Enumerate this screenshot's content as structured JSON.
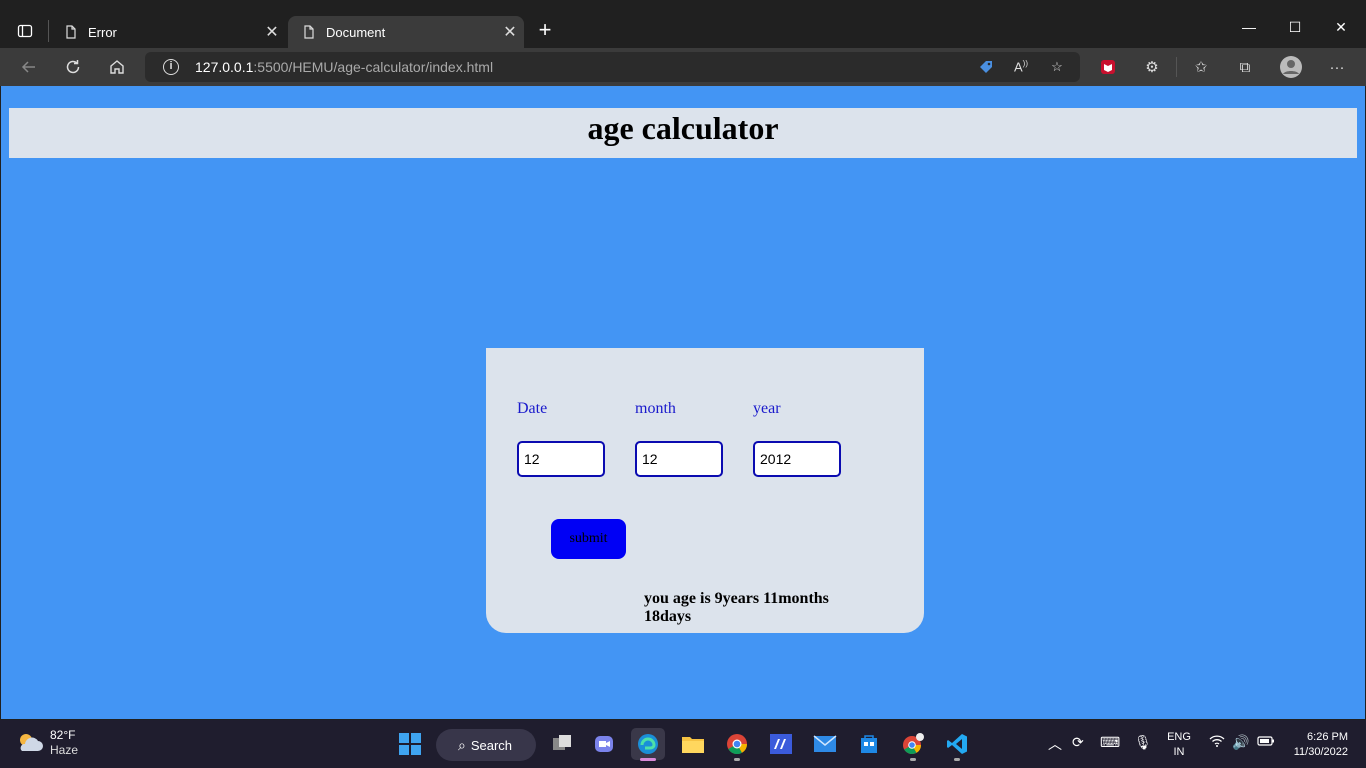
{
  "browser": {
    "tabs": [
      {
        "title": "Error",
        "active": false
      },
      {
        "title": "Document",
        "active": true
      }
    ],
    "url_host": "127.0.0.1",
    "url_rest": ":5500/HEMU/age-calculator/index.html"
  },
  "page": {
    "title": "age calculator",
    "fields": [
      {
        "label": "Date",
        "value": "12"
      },
      {
        "label": "month",
        "value": "12"
      },
      {
        "label": "year",
        "value": "2012"
      }
    ],
    "submit_label": "submit",
    "result": "you age is 9years 11months 18days",
    "colors": {
      "background": "#4395f4",
      "panel": "#dce3ec",
      "button": "#0000f5",
      "label": "#1a1acc"
    }
  },
  "taskbar": {
    "weather_temp": "82°F",
    "weather_desc": "Haze",
    "search_label": "Search",
    "lang_top": "ENG",
    "lang_bottom": "IN",
    "time": "6:26 PM",
    "date": "11/30/2022"
  }
}
